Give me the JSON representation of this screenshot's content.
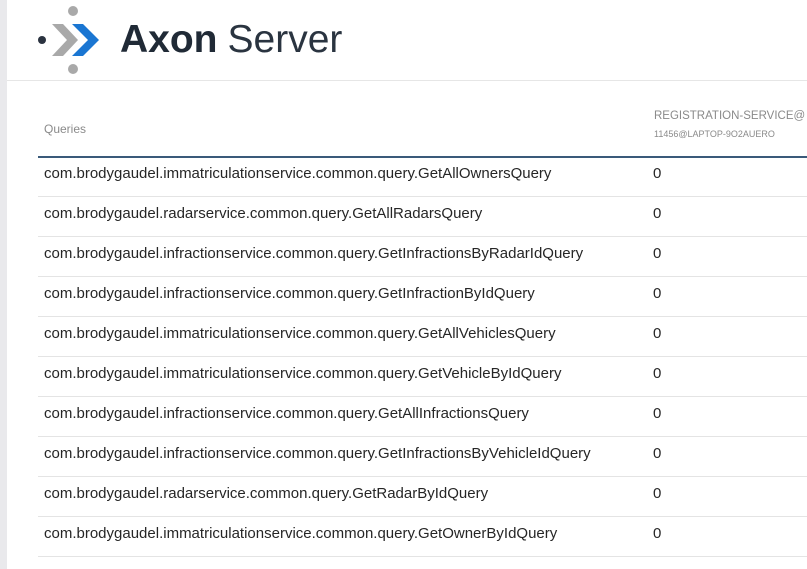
{
  "brand": {
    "name_bold": "Axon",
    "name_light": "Server",
    "colors": {
      "dark": "#202a36",
      "gray": "#a9a9a9",
      "blue": "#1a76d2"
    }
  },
  "table": {
    "queries_header": "Queries",
    "service_header": "REGISTRATION-SERVICE@",
    "service_subheader": "11456@LAPTOP-9O2AUERO",
    "rows": [
      {
        "query": "com.brodygaudel.immatriculationservice.common.query.GetAllOwnersQuery",
        "count": "0"
      },
      {
        "query": "com.brodygaudel.radarservice.common.query.GetAllRadarsQuery",
        "count": "0"
      },
      {
        "query": "com.brodygaudel.infractionservice.common.query.GetInfractionsByRadarIdQuery",
        "count": "0"
      },
      {
        "query": "com.brodygaudel.infractionservice.common.query.GetInfractionByIdQuery",
        "count": "0"
      },
      {
        "query": "com.brodygaudel.immatriculationservice.common.query.GetAllVehiclesQuery",
        "count": "0"
      },
      {
        "query": "com.brodygaudel.immatriculationservice.common.query.GetVehicleByIdQuery",
        "count": "0"
      },
      {
        "query": "com.brodygaudel.infractionservice.common.query.GetAllInfractionsQuery",
        "count": "0"
      },
      {
        "query": "com.brodygaudel.infractionservice.common.query.GetInfractionsByVehicleIdQuery",
        "count": "0"
      },
      {
        "query": "com.brodygaudel.radarservice.common.query.GetRadarByIdQuery",
        "count": "0"
      },
      {
        "query": "com.brodygaudel.immatriculationservice.common.query.GetOwnerByIdQuery",
        "count": "0"
      }
    ]
  }
}
